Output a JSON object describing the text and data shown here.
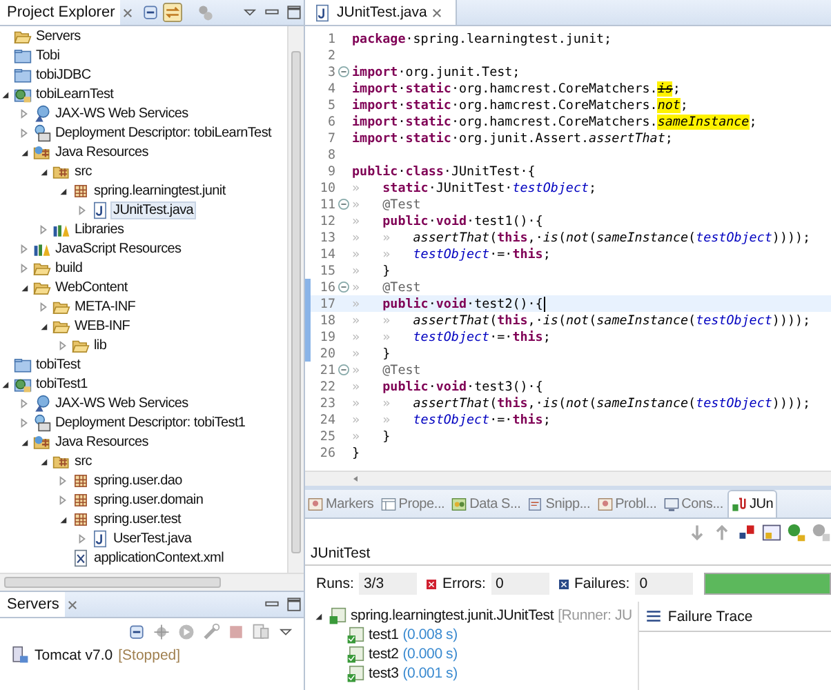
{
  "explorer": {
    "title": "Project Explorer",
    "items": [
      {
        "label": "Servers",
        "kind": "openfolder",
        "selected": false
      },
      {
        "label": "Tobi",
        "kind": "project",
        "selected": false
      },
      {
        "label": "tobiJDBC",
        "kind": "project",
        "selected": false
      },
      {
        "label": "tobiLearnTest",
        "kind": "webproject",
        "selected": false,
        "expanded": true,
        "children": [
          {
            "label": "JAX-WS Web Services",
            "kind": "webservice",
            "selected": false,
            "expanded": false
          },
          {
            "label": "Deployment Descriptor: tobiLearnTest",
            "kind": "descriptor",
            "selected": false,
            "expanded": false
          },
          {
            "label": "Java Resources",
            "kind": "javares",
            "selected": false,
            "expanded": true,
            "children": [
              {
                "label": "src",
                "kind": "srcfolder",
                "selected": false,
                "expanded": true,
                "children": [
                  {
                    "label": "spring.learningtest.junit",
                    "kind": "package",
                    "selected": false,
                    "expanded": true,
                    "children": [
                      {
                        "label": "JUnitTest.java",
                        "kind": "javafile",
                        "selected": true,
                        "expanded": false
                      }
                    ]
                  }
                ]
              },
              {
                "label": "Libraries",
                "kind": "library",
                "selected": false,
                "expanded": false
              }
            ]
          },
          {
            "label": "JavaScript Resources",
            "kind": "library",
            "selected": false,
            "expanded": false
          },
          {
            "label": "build",
            "kind": "openfolder",
            "selected": false,
            "expanded": false
          },
          {
            "label": "WebContent",
            "kind": "openfolder",
            "selected": false,
            "expanded": true,
            "children": [
              {
                "label": "META-INF",
                "kind": "openfolder",
                "selected": false,
                "expanded": false
              },
              {
                "label": "WEB-INF",
                "kind": "openfolder",
                "selected": false,
                "expanded": true,
                "children": [
                  {
                    "label": "lib",
                    "kind": "openfolder",
                    "selected": false,
                    "expanded": false
                  }
                ]
              }
            ]
          }
        ]
      },
      {
        "label": "tobiTest",
        "kind": "project",
        "selected": false
      },
      {
        "label": "tobiTest1",
        "kind": "webproject",
        "selected": false,
        "expanded": true,
        "children": [
          {
            "label": "JAX-WS Web Services",
            "kind": "webservice",
            "selected": false,
            "expanded": false
          },
          {
            "label": "Deployment Descriptor: tobiTest1",
            "kind": "descriptor",
            "selected": false,
            "expanded": false
          },
          {
            "label": "Java Resources",
            "kind": "javares",
            "selected": false,
            "expanded": true,
            "children": [
              {
                "label": "src",
                "kind": "srcfolder",
                "selected": false,
                "expanded": true,
                "children": [
                  {
                    "label": "spring.user.dao",
                    "kind": "package",
                    "selected": false,
                    "expanded": false
                  },
                  {
                    "label": "spring.user.domain",
                    "kind": "package",
                    "selected": false,
                    "expanded": false
                  },
                  {
                    "label": "spring.user.test",
                    "kind": "package",
                    "selected": false,
                    "expanded": true,
                    "children": [
                      {
                        "label": "UserTest.java",
                        "kind": "javafile",
                        "selected": false,
                        "expanded": false
                      }
                    ]
                  },
                  {
                    "label": "applicationContext.xml",
                    "kind": "xmlfile",
                    "selected": false
                  }
                ]
              }
            ]
          }
        ]
      }
    ]
  },
  "servers": {
    "title": "Servers",
    "items": [
      {
        "label": "Tomcat v7.0",
        "status": "[Stopped]"
      }
    ]
  },
  "editor": {
    "tab": "JUnitTest.java",
    "lines": [
      {
        "n": "1",
        "changed": false,
        "current": false,
        "code": [
          {
            "kind": "kw",
            "text": "package"
          },
          {
            "kind": "t",
            "text": "·spring.learningtest.junit;"
          }
        ]
      },
      {
        "n": "2",
        "changed": false,
        "current": false
      },
      {
        "n": "3",
        "changed": false,
        "current": false,
        "folded": false,
        "code": [
          {
            "kind": "kw",
            "text": "import"
          },
          {
            "kind": "t",
            "text": "·org.junit.Test;"
          }
        ]
      },
      {
        "n": "4",
        "changed": false,
        "current": false,
        "code": [
          {
            "kind": "kw",
            "text": "import"
          },
          {
            "kind": "t",
            "text": "·"
          },
          {
            "kind": "kw",
            "text": "static"
          },
          {
            "kind": "t",
            "text": "·org.hamcrest.CoreMatchers."
          },
          {
            "kind": "dep",
            "text": "is"
          },
          {
            "kind": "t",
            "text": ";"
          }
        ]
      },
      {
        "n": "5",
        "changed": false,
        "current": false,
        "code": [
          {
            "kind": "kw",
            "text": "import"
          },
          {
            "kind": "t",
            "text": "·"
          },
          {
            "kind": "kw",
            "text": "static"
          },
          {
            "kind": "t",
            "text": "·org.hamcrest.CoreMatchers."
          },
          {
            "kind": "hl",
            "text": "not"
          },
          {
            "kind": "t",
            "text": ";"
          }
        ]
      },
      {
        "n": "6",
        "changed": false,
        "current": false,
        "code": [
          {
            "kind": "kw",
            "text": "import"
          },
          {
            "kind": "t",
            "text": "·"
          },
          {
            "kind": "kw",
            "text": "static"
          },
          {
            "kind": "t",
            "text": "·org.hamcrest.CoreMatchers."
          },
          {
            "kind": "hl",
            "text": "sameInstance"
          },
          {
            "kind": "t",
            "text": ";"
          }
        ]
      },
      {
        "n": "7",
        "changed": false,
        "current": false,
        "code": [
          {
            "kind": "kw",
            "text": "import"
          },
          {
            "kind": "t",
            "text": "·"
          },
          {
            "kind": "kw",
            "text": "static"
          },
          {
            "kind": "t",
            "text": "·org.junit.Assert."
          },
          {
            "kind": "it",
            "text": "assertThat"
          },
          {
            "kind": "t",
            "text": ";"
          }
        ]
      },
      {
        "n": "8",
        "changed": false,
        "current": false
      },
      {
        "n": "9",
        "changed": false,
        "current": false,
        "code": [
          {
            "kind": "kw",
            "text": "public"
          },
          {
            "kind": "t",
            "text": "·"
          },
          {
            "kind": "kw",
            "text": "class"
          },
          {
            "kind": "t",
            "text": "·JUnitTest·{"
          }
        ]
      },
      {
        "n": "10",
        "changed": false,
        "current": false,
        "code": [
          {
            "kind": "ws",
            "text": "»\t"
          },
          {
            "kind": "kw",
            "text": "static"
          },
          {
            "kind": "t",
            "text": "·JUnitTest·"
          },
          {
            "kind": "fld",
            "text": "testObject"
          },
          {
            "kind": "t",
            "text": ";"
          }
        ]
      },
      {
        "n": "11",
        "changed": false,
        "current": false,
        "folded": false,
        "code": [
          {
            "kind": "ws",
            "text": "»\t"
          },
          {
            "kind": "ann",
            "text": "@Test"
          }
        ]
      },
      {
        "n": "12",
        "changed": false,
        "current": false,
        "code": [
          {
            "kind": "ws",
            "text": "»\t"
          },
          {
            "kind": "kw",
            "text": "public"
          },
          {
            "kind": "t",
            "text": "·"
          },
          {
            "kind": "kw",
            "text": "void"
          },
          {
            "kind": "t",
            "text": "·test1()·{"
          }
        ]
      },
      {
        "n": "13",
        "changed": false,
        "current": false,
        "code": [
          {
            "kind": "ws",
            "text": "»\t»\t"
          },
          {
            "kind": "it",
            "text": "assertThat"
          },
          {
            "kind": "t",
            "text": "("
          },
          {
            "kind": "kw",
            "text": "this"
          },
          {
            "kind": "t",
            "text": ",·"
          },
          {
            "kind": "it",
            "text": "is"
          },
          {
            "kind": "t",
            "text": "("
          },
          {
            "kind": "it",
            "text": "not"
          },
          {
            "kind": "t",
            "text": "("
          },
          {
            "kind": "it",
            "text": "sameInstance"
          },
          {
            "kind": "t",
            "text": "("
          },
          {
            "kind": "fld",
            "text": "testObject"
          },
          {
            "kind": "t",
            "text": "))));"
          }
        ]
      },
      {
        "n": "14",
        "changed": false,
        "current": false,
        "code": [
          {
            "kind": "ws",
            "text": "»\t»\t"
          },
          {
            "kind": "fld",
            "text": "testObject"
          },
          {
            "kind": "t",
            "text": "·=·"
          },
          {
            "kind": "kw",
            "text": "this"
          },
          {
            "kind": "t",
            "text": ";"
          }
        ]
      },
      {
        "n": "15",
        "changed": false,
        "current": false,
        "code": [
          {
            "kind": "ws",
            "text": "»\t"
          },
          {
            "kind": "t",
            "text": "}"
          }
        ]
      },
      {
        "n": "16",
        "changed": true,
        "current": false,
        "folded": false,
        "code": [
          {
            "kind": "ws",
            "text": "»\t"
          },
          {
            "kind": "ann",
            "text": "@Test"
          }
        ]
      },
      {
        "n": "17",
        "changed": true,
        "current": true,
        "code": [
          {
            "kind": "ws",
            "text": "»\t"
          },
          {
            "kind": "kw",
            "text": "public"
          },
          {
            "kind": "t",
            "text": "·"
          },
          {
            "kind": "kw",
            "text": "void"
          },
          {
            "kind": "t",
            "text": "·test2()·{"
          }
        ]
      },
      {
        "n": "18",
        "changed": true,
        "current": false,
        "code": [
          {
            "kind": "ws",
            "text": "»\t»\t"
          },
          {
            "kind": "it",
            "text": "assertThat"
          },
          {
            "kind": "t",
            "text": "("
          },
          {
            "kind": "kw",
            "text": "this"
          },
          {
            "kind": "t",
            "text": ",·"
          },
          {
            "kind": "it",
            "text": "is"
          },
          {
            "kind": "t",
            "text": "("
          },
          {
            "kind": "it",
            "text": "not"
          },
          {
            "kind": "t",
            "text": "("
          },
          {
            "kind": "it",
            "text": "sameInstance"
          },
          {
            "kind": "t",
            "text": "("
          },
          {
            "kind": "fld",
            "text": "testObject"
          },
          {
            "kind": "t",
            "text": "))));"
          }
        ]
      },
      {
        "n": "19",
        "changed": true,
        "current": false,
        "code": [
          {
            "kind": "ws",
            "text": "»\t»\t"
          },
          {
            "kind": "fld",
            "text": "testObject"
          },
          {
            "kind": "t",
            "text": "·=·"
          },
          {
            "kind": "kw",
            "text": "this"
          },
          {
            "kind": "t",
            "text": ";"
          }
        ]
      },
      {
        "n": "20",
        "changed": true,
        "current": false,
        "code": [
          {
            "kind": "ws",
            "text": "»\t"
          },
          {
            "kind": "t",
            "text": "}"
          }
        ]
      },
      {
        "n": "21",
        "changed": false,
        "current": false,
        "folded": false,
        "code": [
          {
            "kind": "ws",
            "text": "»\t"
          },
          {
            "kind": "ann",
            "text": "@Test"
          }
        ]
      },
      {
        "n": "22",
        "changed": false,
        "current": false,
        "code": [
          {
            "kind": "ws",
            "text": "»\t"
          },
          {
            "kind": "kw",
            "text": "public"
          },
          {
            "kind": "t",
            "text": "·"
          },
          {
            "kind": "kw",
            "text": "void"
          },
          {
            "kind": "t",
            "text": "·test3()·{"
          }
        ]
      },
      {
        "n": "23",
        "changed": false,
        "current": false,
        "code": [
          {
            "kind": "ws",
            "text": "»\t»\t"
          },
          {
            "kind": "it",
            "text": "assertThat"
          },
          {
            "kind": "t",
            "text": "("
          },
          {
            "kind": "kw",
            "text": "this"
          },
          {
            "kind": "t",
            "text": ",·"
          },
          {
            "kind": "it",
            "text": "is"
          },
          {
            "kind": "t",
            "text": "("
          },
          {
            "kind": "it",
            "text": "not"
          },
          {
            "kind": "t",
            "text": "("
          },
          {
            "kind": "it",
            "text": "sameInstance"
          },
          {
            "kind": "t",
            "text": "("
          },
          {
            "kind": "fld",
            "text": "testObject"
          },
          {
            "kind": "t",
            "text": "))));"
          }
        ]
      },
      {
        "n": "24",
        "changed": false,
        "current": false,
        "code": [
          {
            "kind": "ws",
            "text": "»\t»\t"
          },
          {
            "kind": "fld",
            "text": "testObject"
          },
          {
            "kind": "t",
            "text": "·=·"
          },
          {
            "kind": "kw",
            "text": "this"
          },
          {
            "kind": "t",
            "text": ";"
          }
        ]
      },
      {
        "n": "25",
        "changed": false,
        "current": false,
        "code": [
          {
            "kind": "ws",
            "text": "»\t"
          },
          {
            "kind": "t",
            "text": "}"
          }
        ]
      },
      {
        "n": "26",
        "changed": false,
        "current": false,
        "code": [
          {
            "kind": "t",
            "text": "}"
          }
        ]
      }
    ]
  },
  "bottom": {
    "tabs": [
      {
        "label": "Markers",
        "kind": "markers",
        "selected": false
      },
      {
        "label": "Prope...",
        "kind": "properties",
        "selected": false
      },
      {
        "label": "Data S...",
        "kind": "data",
        "selected": false
      },
      {
        "label": "Snipp...",
        "kind": "snippets",
        "selected": false
      },
      {
        "label": "Probl...",
        "kind": "markers",
        "selected": false
      },
      {
        "label": "Cons...",
        "kind": "console",
        "selected": false
      },
      {
        "label": "JUn",
        "kind": "junit",
        "selected": true
      }
    ],
    "junit": {
      "title": "JUnitTest",
      "runs_label": "Runs:",
      "runs": "3/3",
      "errors_label": "Errors:",
      "errors": "0",
      "failures_label": "Failures:",
      "failures": "0",
      "level": 1,
      "root": {
        "label": "spring.learningtest.junit.JUnitTest",
        "runner": "[Runner: JU",
        "expanded": true
      },
      "tests": [
        {
          "label": "test1",
          "time": "(0.008 s)"
        },
        {
          "label": "test2",
          "time": "(0.000 s)"
        },
        {
          "label": "test3",
          "time": "(0.001 s)"
        }
      ],
      "trace_title": "Failure Trace"
    }
  }
}
